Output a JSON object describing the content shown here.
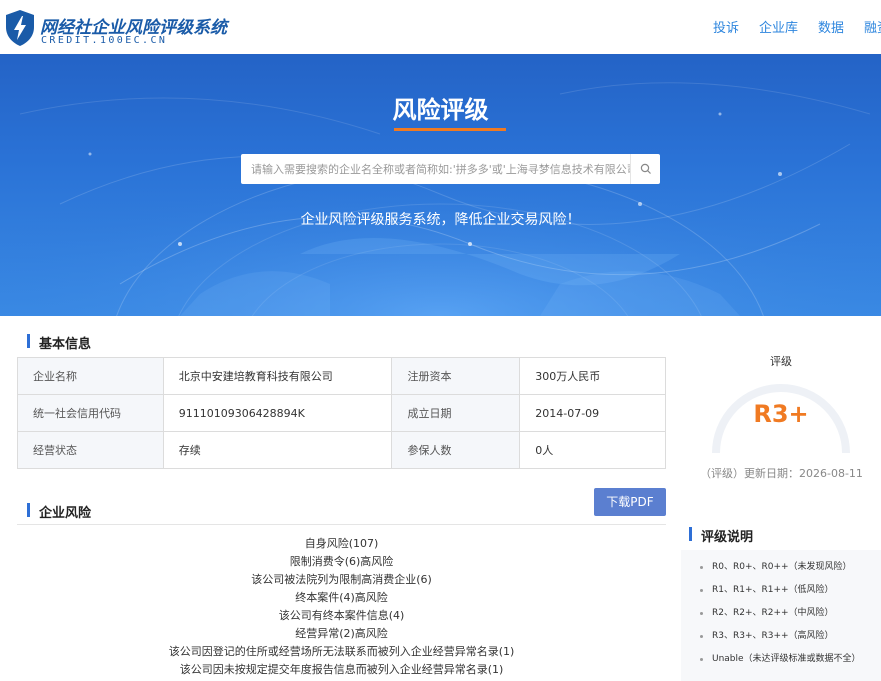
{
  "header": {
    "logo_title": "网经社企业风险评级系统",
    "logo_subtitle": "CREDIT.100EC.CN",
    "nav": [
      "投诉",
      "企业库",
      "数据",
      "融资"
    ]
  },
  "hero": {
    "title": "风险评级",
    "search_placeholder": "请输入需要搜索的企业名全称或者简称如:'拼多多'或'上海寻梦信息技术有限公司'",
    "slogan": "企业风险评级服务系统，降低企业交易风险！"
  },
  "basic_info": {
    "title": "基本信息",
    "rows": [
      [
        "企业名称",
        "北京中安建培教育科技有限公司",
        "注册资本",
        "300万人民币"
      ],
      [
        "统一社会信用代码",
        "91110109306428894K",
        "成立日期",
        "2014-07-09"
      ],
      [
        "经营状态",
        "存续",
        "参保人数",
        "0人"
      ]
    ]
  },
  "rating": {
    "label": "评级",
    "value": "R3+",
    "date": "（评级）更新日期：2026-08-11",
    "accent": "#f07a22"
  },
  "risk": {
    "title": "企业风险",
    "download_label": "下载PDF",
    "items": [
      "自身风险(107)",
      "限制消费令(6)高风险",
      "该公司被法院列为限制高消费企业(6)",
      "终本案件(4)高风险",
      "该公司有终本案件信息(4)",
      "经营异常(2)高风险",
      "该公司因登记的住所或经营场所无法联系而被列入企业经营异常名录(1)",
      "该公司因未按规定提交年度报告信息而被列入企业经营异常名录(1)"
    ]
  },
  "rating_explain": {
    "title": "评级说明",
    "items": [
      "R0、R0+、R0++（未发现风险）",
      "R1、R1+、R1++（低风险）",
      "R2、R2+、R2++（中风险）",
      "R3、R3+、R3++（高风险）",
      "Unable（未达评级标准或数据不全）"
    ]
  }
}
